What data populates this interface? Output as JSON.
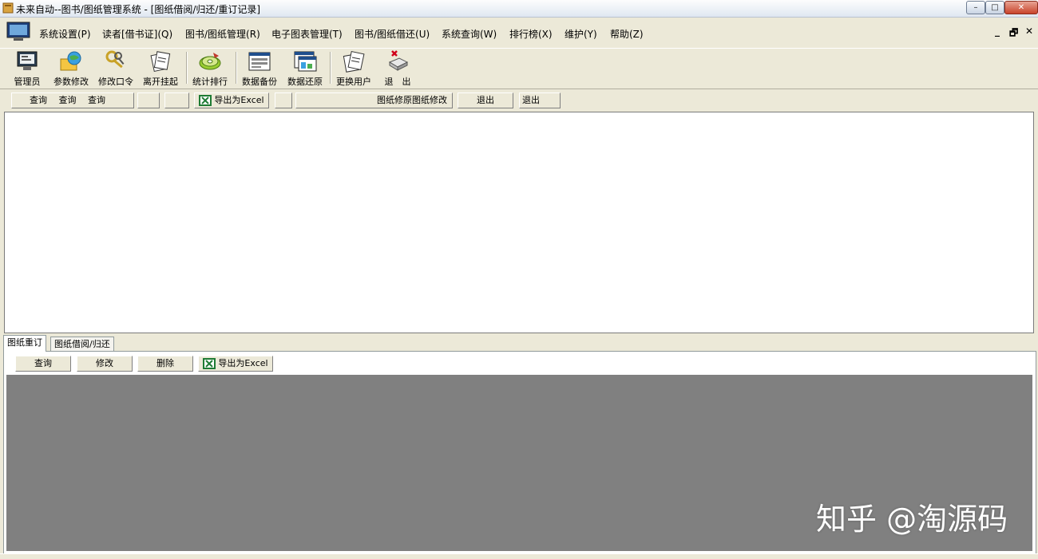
{
  "window": {
    "title": "未来自动--图书/图纸管理系统 - [图纸借阅/归还/重订记录]",
    "minimize": "–",
    "maximize": "□",
    "close": "✕"
  },
  "menu": {
    "items": [
      "系统设置(P)",
      "读者[借书证](Q)",
      "图书/图纸管理(R)",
      "电子图表管理(T)",
      "图书/图纸借还(U)",
      "系统查询(W)",
      "排行榜(X)",
      "维护(Y)",
      "帮助(Z)"
    ],
    "mdi_min": "_",
    "mdi_restore": "🗗",
    "mdi_close": "✕"
  },
  "toolbar": {
    "items": [
      "管理员",
      "参数修改",
      "修改口令",
      "离开挂起",
      "统计排行",
      "数据备份",
      "数据还原",
      "更换用户",
      "退　出"
    ]
  },
  "top_buttons": {
    "query_group": "查询　 查询　 查询",
    "export": "导出为Excel",
    "modify": "图纸修原图纸修改",
    "exit1": "退出",
    "exit2": "退出"
  },
  "tabs": {
    "reorder": "图纸重订",
    "borrow_return": "图纸借阅/归还"
  },
  "bottom_buttons": {
    "query": "查询",
    "modify": "修改",
    "delete": "删除",
    "export": "导出为Excel"
  },
  "watermark": "知乎 @淘源码",
  "colors": {
    "window_bg": "#ece9d8",
    "grid_bg_dark": "#808080",
    "grid_bg_light": "#ffffff"
  }
}
